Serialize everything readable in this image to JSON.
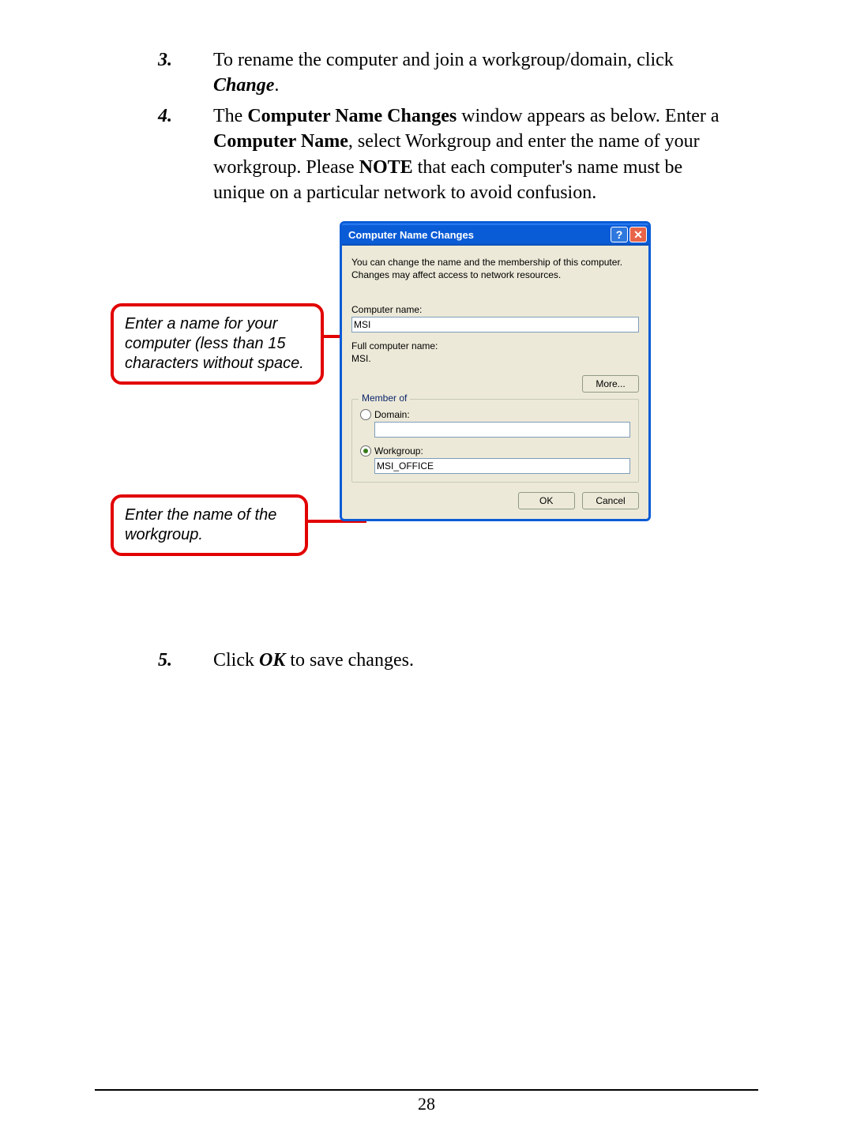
{
  "steps": {
    "s3": {
      "num": "3.",
      "pre": "To rename the computer and join a workgroup/domain, click ",
      "change": "Change",
      "post": "."
    },
    "s4": {
      "num": "4.",
      "t1": "The ",
      "win_name": "Computer Name Changes",
      "t2": " window appears as below.  Enter a ",
      "comp_name_bold": "Computer Name",
      "t3": ", select Workgroup and enter the name of your workgroup.  Please ",
      "note": "NOTE",
      "t4": " that each computer's name must be unique on a particular network to avoid confusion."
    },
    "s5": {
      "num": "5.",
      "t1": "Click ",
      "ok": "OK",
      "t2": " to save changes."
    }
  },
  "dialog": {
    "title": "Computer Name Changes",
    "desc": "You can change the name and the membership of this computer. Changes may affect access to network resources.",
    "computer_name_label": "Computer name:",
    "computer_name_value": "MSI",
    "full_name_label": "Full computer name:",
    "full_name_value": "MSI.",
    "more_button": "More...",
    "member_legend": "Member of",
    "domain_label": "Domain:",
    "domain_value": "",
    "workgroup_label": "Workgroup:",
    "workgroup_value": "MSI_OFFICE",
    "ok": "OK",
    "cancel": "Cancel",
    "help_glyph": "?",
    "close_glyph": "✕"
  },
  "callouts": {
    "c1": "Enter a name for your computer (less than 15 characters without space.",
    "c2": "Enter the name of the workgroup."
  },
  "page_number": "28"
}
